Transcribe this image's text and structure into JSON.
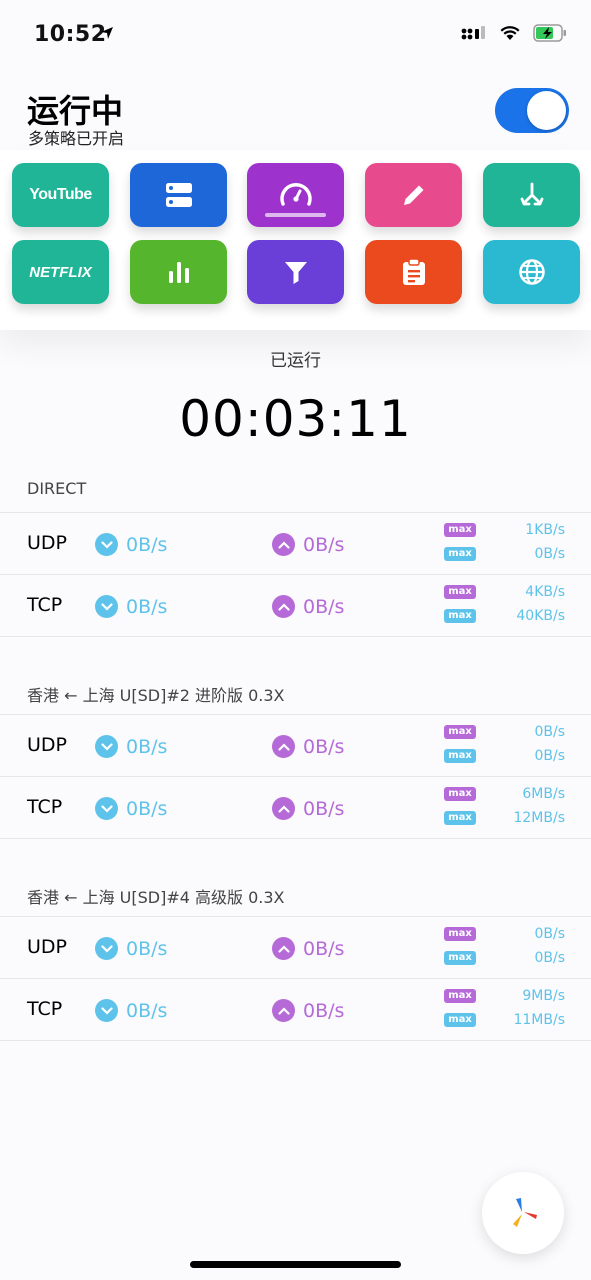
{
  "status_bar": {
    "time": "10:52"
  },
  "header": {
    "title": "运行中",
    "subtitle": "多策略已开启",
    "toggle_on": true
  },
  "tiles": [
    {
      "name": "youtube-tile",
      "label": "YouTube",
      "icon": "youtube-logo",
      "color": "#21b597"
    },
    {
      "name": "servers-tile",
      "icon": "server-icon",
      "color": "#1d67d8"
    },
    {
      "name": "speed-tile",
      "icon": "speedometer-icon",
      "color": "#9d33cc",
      "selected": true
    },
    {
      "name": "edit-tile",
      "icon": "pencil-icon",
      "color": "#e84b8d"
    },
    {
      "name": "route-tile",
      "icon": "merge-arrow-icon",
      "color": "#21b597"
    },
    {
      "name": "netflix-tile",
      "label": "NETFLIX",
      "icon": "netflix-logo",
      "color": "#21b597"
    },
    {
      "name": "stats-tile",
      "icon": "bar-chart-icon",
      "color": "#55b52c"
    },
    {
      "name": "filter-tile",
      "icon": "filter-icon",
      "color": "#6a3fd8"
    },
    {
      "name": "clipboard-tile",
      "icon": "clipboard-icon",
      "color": "#ea4a1d"
    },
    {
      "name": "globe-tile",
      "icon": "globe-icon",
      "color": "#2ab9d0"
    }
  ],
  "runtime": {
    "label": "已运行",
    "value": "00:03:11"
  },
  "sections": [
    {
      "title": "DIRECT",
      "rows": [
        {
          "proto": "UDP",
          "down": "0B/s",
          "up": "0B/s",
          "max_label": "max",
          "max_up": "1KB/s",
          "max_down": "0B/s"
        },
        {
          "proto": "TCP",
          "down": "0B/s",
          "up": "0B/s",
          "max_label": "max",
          "max_up": "4KB/s",
          "max_down": "40KB/s"
        }
      ]
    },
    {
      "title": "香港 ← 上海 U[SD]#2 进阶版 0.3X",
      "rows": [
        {
          "proto": "UDP",
          "down": "0B/s",
          "up": "0B/s",
          "max_label": "max",
          "max_up": "0B/s",
          "max_down": "0B/s"
        },
        {
          "proto": "TCP",
          "down": "0B/s",
          "up": "0B/s",
          "max_label": "max",
          "max_up": "6MB/s",
          "max_down": "12MB/s"
        }
      ]
    },
    {
      "title": "香港 ← 上海 U[SD]#4 高级版 0.3X",
      "rows": [
        {
          "proto": "UDP",
          "down": "0B/s",
          "up": "0B/s",
          "max_label": "max",
          "max_up": "0B/s",
          "max_down": "0B/s"
        },
        {
          "proto": "TCP",
          "down": "0B/s",
          "up": "0B/s",
          "max_label": "max",
          "max_up": "9MB/s",
          "max_down": "11MB/s"
        }
      ]
    }
  ],
  "colors": {
    "accent": "#1a73e8",
    "download": "#5ec3ea",
    "upload": "#b56ad8"
  }
}
